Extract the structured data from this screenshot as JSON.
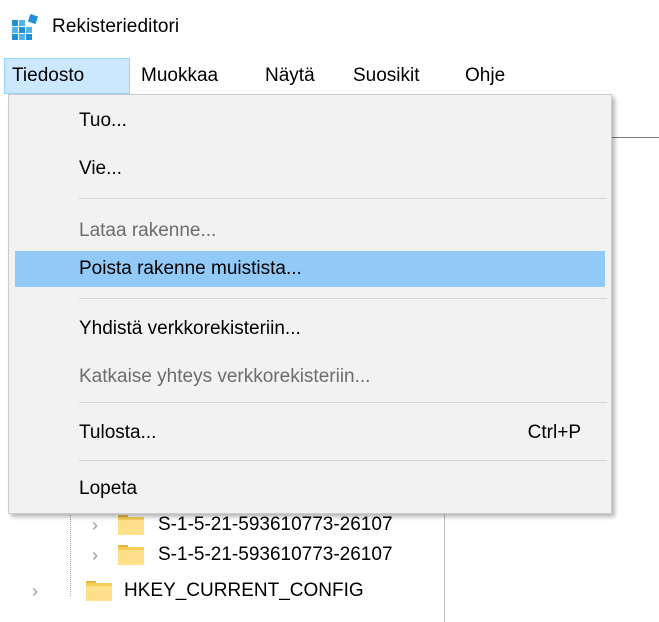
{
  "window": {
    "title": "Rekisterieditori",
    "app_icon": "registry-editor-icon"
  },
  "menubar": {
    "items": [
      {
        "label": "Tiedosto",
        "active": true
      },
      {
        "label": "Muokkaa",
        "active": false
      },
      {
        "label": "Näytä",
        "active": false
      },
      {
        "label": "Suosikit",
        "active": false
      },
      {
        "label": "Ohje",
        "active": false
      }
    ]
  },
  "file_menu": {
    "items": [
      {
        "label": "Tuo...",
        "enabled": true
      },
      {
        "label": "Vie...",
        "enabled": true
      },
      {
        "label": "Lataa rakenne...",
        "enabled": false
      },
      {
        "label": "Poista rakenne muistista...",
        "enabled": true,
        "highlighted": true
      },
      {
        "label": "Yhdistä verkkorekisteriin...",
        "enabled": true
      },
      {
        "label": "Katkaise yhteys verkkorekisteriin...",
        "enabled": false
      },
      {
        "label": "Tulosta...",
        "enabled": true,
        "shortcut": "Ctrl+P"
      },
      {
        "label": "Lopeta",
        "enabled": true
      }
    ]
  },
  "tree": {
    "rows": [
      {
        "label": "S-1-5-21-593610773-26107",
        "icon": "folder-icon",
        "expander": "chevron-right-icon"
      },
      {
        "label": "S-1-5-21-593610773-26107",
        "icon": "folder-icon",
        "expander": "chevron-right-icon"
      },
      {
        "label": "HKEY_CURRENT_CONFIG",
        "icon": "folder-icon",
        "expander": "chevron-right-icon"
      }
    ]
  },
  "colors": {
    "menu_background": "#f2f2f2",
    "menu_highlight": "#91c9f7",
    "menubar_active": "#cce8ff",
    "disabled_text": "#6d6d6d",
    "folder_yellow": "#f5cd5a"
  }
}
